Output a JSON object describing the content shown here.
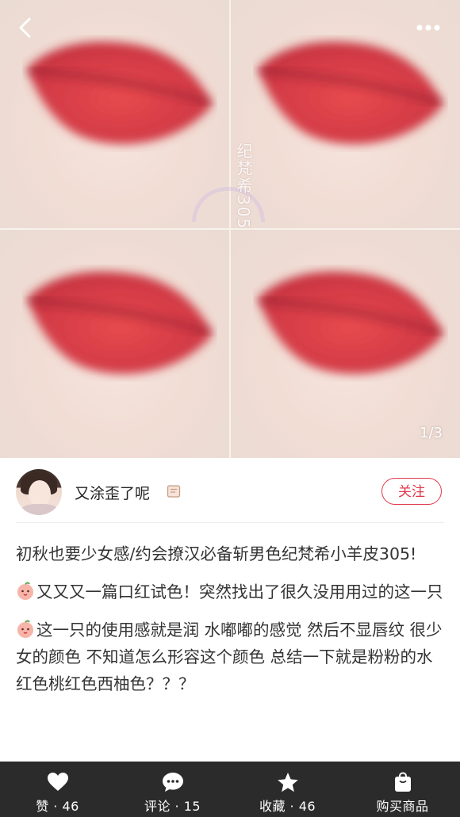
{
  "gallery": {
    "counter": "1/3",
    "watermark": "纪梵希305"
  },
  "author": {
    "name": "又涂歪了呢"
  },
  "actions": {
    "follow": "关注"
  },
  "post": {
    "paragraphs": [
      "初秋也要少女感/约会撩汉必备斩男色纪梵希小羊皮305!",
      "又又又一篇口红试色！突然找出了很久没用用过的这一只",
      "这一只的使用感就是润 水嘟嘟的感觉 然后不显唇纹 很少女的颜色 不知道怎么形容这个颜色 总结一下就是粉粉的水红色桃红色西柚色？？？"
    ]
  },
  "bottom_bar": {
    "like": "赞 · 46",
    "comment": "评论 · 15",
    "collect": "收藏 · 46",
    "buy": "购买商品"
  },
  "colors": {
    "accent": "#e0384b",
    "bar": "#2b2b2b"
  },
  "icons": [
    "back-arrow-icon",
    "more-dots-icon",
    "note-icon",
    "emoji-icon",
    "heart-icon",
    "comment-icon",
    "star-icon",
    "shopping-bag-icon"
  ]
}
